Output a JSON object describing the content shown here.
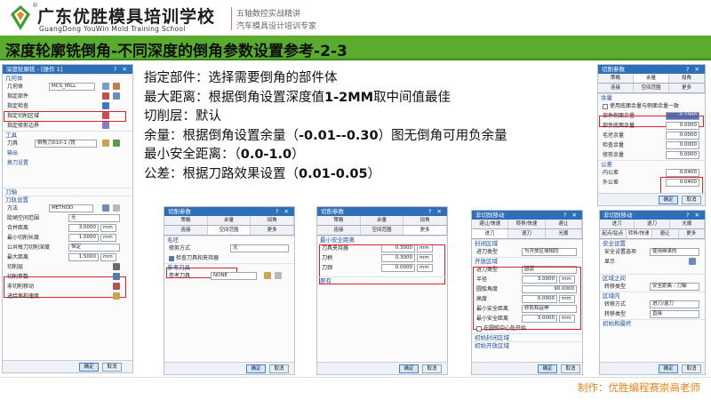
{
  "header": {
    "school_cn": "广东优胜模具培训学校",
    "school_en": "GuangDong YouWin Mold Training School",
    "registered": "®",
    "sub1": "五轴数控实战精讲",
    "sub2": "汽车模具设计培训专家"
  },
  "slide_title": "深度轮廓铣倒角-不同深度的倒角参数设置参考-2-3",
  "notes": {
    "line1": "指定部件：选择需要倒角的部件体",
    "line2_a": "最大距离：根据倒角设置深度值",
    "line2_b": "1-2MM",
    "line2_c": "取中间值最佳",
    "line3": "切削层：默认",
    "line4_a": "余量：根据倒角设置余量（",
    "line4_b": "-0.01--0.30",
    "line4_c": "）图无倒角可用负余量",
    "line5_a": "最小安全距离：（",
    "line5_b": "0.0-1.0",
    "line5_c": "）",
    "line6_a": "公差：根据刀路效果设置（",
    "line6_b": "0.01-0.05",
    "line6_c": "）"
  },
  "footer": "制作：优胜编程赛崇高老师",
  "dlg_main": {
    "title": "深度轮廓铣 - [操作 1]",
    "geometry": "几何体",
    "geometry_label": "几何体",
    "geometry_value": "MCS_MILL",
    "part": "指定部件",
    "check": "指定检查",
    "cut_area": "指定切削区域",
    "trim": "指定修剪边界",
    "tool_group": "工具",
    "tool_label": "刀具",
    "tool_value": "倒角刀D10-1 (铣",
    "output": "输出",
    "tool_change": "换刀设置",
    "axis_group": "刀轴",
    "path_group": "刀轨设置",
    "method_label": "方法",
    "method_value": "METHOD",
    "steep_label": "陡峭空间范围",
    "steep_value": "无",
    "merge_label": "合并距离",
    "merge_value": "3.0000",
    "min_cut_label": "最小切削长度",
    "min_cut_value": "1.0000",
    "common_depth_label": "公共每刀切削深度",
    "common_depth_value": "恒定",
    "max_dist_label": "最大距离",
    "max_dist_value": "1.5000",
    "unit": "mm",
    "cut_layers": "切削层",
    "cut_params": "切削参数",
    "non_cut": "非切削移动",
    "feeds": "进给率和速度",
    "ok": "确定",
    "cancel": "取消"
  },
  "dlg_a": {
    "title": "切削参数",
    "tabs": [
      "策略",
      "余量",
      "拐角",
      "连接",
      "空间范围",
      "更多"
    ],
    "blank": "毛坯",
    "trim_label": "修剪方式",
    "trim_value": "无",
    "check_tool": "检查刀具和夹持器",
    "ref_tool_group": "参考刀具",
    "ref_tool_label": "参考刀具",
    "ref_tool_value": "NONE",
    "ok": "确定",
    "cancel": "取消"
  },
  "dlg_b": {
    "title": "切削参数",
    "tabs": [
      "策略",
      "余量",
      "拐角",
      "连接",
      "空间范围",
      "更多"
    ],
    "safe_group": "最小安全距离",
    "holder_label": "刀具夹持器",
    "holder_value": "0.3000",
    "shank_label": "刀柄",
    "shank_value": "0.3000",
    "tool_label": "刀颈",
    "tool_value": "0.0000",
    "unit": "mm",
    "misc_group": "原有",
    "ok": "确定",
    "cancel": "取消"
  },
  "dlg_c": {
    "title": "非切削移动",
    "tabs_row1": [
      "避让/快速",
      "转移/快速",
      "避让"
    ],
    "tabs_row2": [
      "进刀",
      "退刀",
      "光顺"
    ],
    "closed_group": "封闭区域",
    "closed_type_label": "进刀类型",
    "closed_type_value": "与开放区域相同",
    "open_group": "开放区域",
    "open_type_label": "进刀类型",
    "open_type_value": "圆弧",
    "radius_label": "半径",
    "radius_value": "3.0000",
    "arc_angle_label": "圆弧角度",
    "arc_angle_value": "90.0000",
    "height_label": "高度",
    "height_value": "0.0000",
    "min_safe_label": "最小安全距离",
    "min_safe_value": "修剪和延伸",
    "min_safe_dist_label": "最小安全距离",
    "min_safe_dist_value": "3.0000",
    "tool_center_label": "在圆弧中心处开始",
    "init_closed": "初始封闭区域",
    "init_open": "初始开放区域",
    "unit": "mm",
    "ok": "确定",
    "cancel": "取消"
  },
  "dlg_d": {
    "title": "切削参数",
    "tabs": [
      "策略",
      "余量",
      "拐角",
      "连接",
      "空间范围",
      "更多"
    ],
    "margin_group": "余量",
    "use_bottom_same": "使用底面余量与侧面余量一致",
    "part_side_label": "部件侧面余量",
    "part_side_value": "-0.1000",
    "part_bottom_label": "部件底面余量",
    "part_bottom_value": "0.0000",
    "blank_label": "毛坯余量",
    "blank_value": "0.0000",
    "check_label": "检查余量",
    "check_value": "0.0000",
    "trim_label": "修剪余量",
    "trim_value": "0.0000",
    "tol_group": "公差",
    "in_tol_label": "内公差",
    "in_tol_value": "0.0400",
    "out_tol_label": "外公差",
    "out_tol_value": "0.0400",
    "ok": "确定",
    "cancel": "取消"
  },
  "dlg_e": {
    "title": "非切削移动",
    "tabs_row1": [
      "进刀",
      "退刀",
      "光顺"
    ],
    "tabs_row2": [
      "起点/钻点",
      "转移/快速",
      "避让",
      "更多"
    ],
    "safe_group": "安全设置",
    "safe_opt_label": "安全设置选项",
    "safe_opt_value": "使用继承的",
    "show_label": "显示",
    "region_between": "区域之间",
    "transfer_type_label": "转移类型",
    "transfer_type_value": "安全距离 - 刀轴",
    "region_inside": "区域内",
    "transfer_mode_label": "转移方式",
    "transfer_mode_value": "进刀/退刀",
    "transfer_type2_label": "转移类型",
    "transfer_type2_value": "直接",
    "init_final": "初始和最终",
    "ok": "确定",
    "cancel": "取消"
  },
  "colors": {
    "title_bar": "#5bab2e",
    "highlight": "#e0202a",
    "footer": "#e8841a"
  }
}
